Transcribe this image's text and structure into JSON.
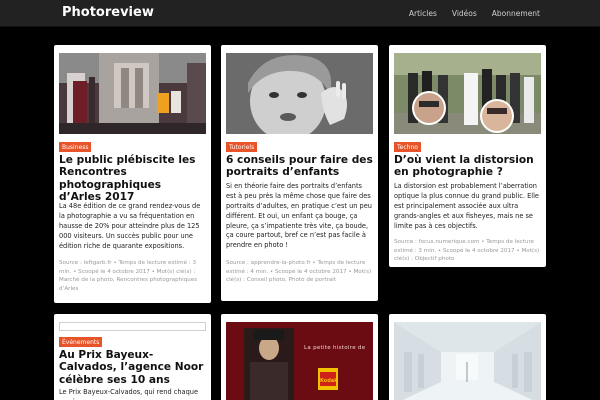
{
  "header": {
    "brand": "Photoreview",
    "nav": [
      "Articles",
      "Vidéos",
      "Abonnement"
    ]
  },
  "colors": {
    "header_bg": "#222222",
    "page_bg": "#000000",
    "badge": "#e8542a"
  },
  "cards": [
    {
      "category": "Business",
      "title": "Le public plébiscite les Rencontres photographiques d’Arles 2017",
      "excerpt": "La 48e édition de ce grand rendez-vous de la photographie a vu sa fréquentation en hausse de 20% pour atteindre plus de 125 000 visiteurs. Un succès public pour une édition riche de quarante expositions.",
      "meta": "Source : leftgarb.fr • Temps de lecture estimé : 3 min. • Scoopé le 4 octobre 2017 • Mot(s) clé(s) : Marché de la photo, Rencontres photographiques d’Arles"
    },
    {
      "category": "Tutoriels",
      "title": "6 conseils pour faire des portraits d’enfants",
      "excerpt": "Si en théorie faire des portraits d’enfants est à peu près la même chose que faire des portraits d’adultes, en pratique c’est un peu différent. Et oui, un enfant ça bouge, ça pleure, ça s’impatiente très vite, ça boude, ça coure partout, bref ce n’est pas facile à prendre en photo !",
      "meta": "Source : apprendre-la-photo.fr • Temps de lecture estimé : 4 min. • Scoopé le 4 octobre 2017 • Mot(s) clé(s) : Conseil photo, Photo de portrait"
    },
    {
      "category": "Techno",
      "title": "D’où vient la distorsion en photographie ?",
      "excerpt": "La distorsion est probablement l’aberration optique la plus connue du grand public. Elle est principalement associée aux ultra grands-angles et aux fisheyes, mais ne se limite pas à ces objectifs.",
      "meta": "Source : focus.numerique.com • Temps de lecture estimé : 3 min. • Scoopé le 4 octobre 2017 • Mot(s) clé(s) : Objectif photo"
    },
    {
      "category": "Événements",
      "title": "Au Prix Bayeux-Calvados, l’agence Noor célèbre ses 10 ans",
      "excerpt": "Le Prix Bayeux-Calvados, qui rend chaque année"
    },
    {
      "image_text": "La petite histoire de",
      "image_logo": "Kodak"
    },
    {}
  ]
}
